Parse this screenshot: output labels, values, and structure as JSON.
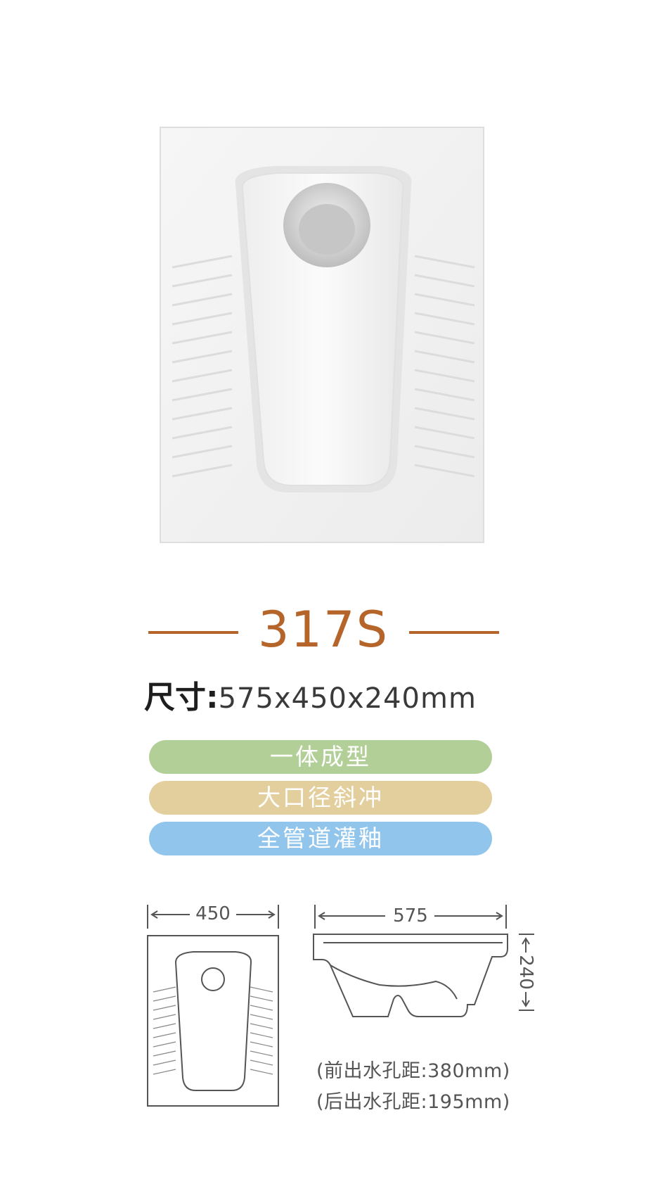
{
  "product": {
    "model": "317S",
    "size_label": "尺寸:",
    "size_value": "575x450x240mm"
  },
  "features": [
    {
      "label": "一体成型",
      "color": "#b3cf98"
    },
    {
      "label": "大口径斜冲",
      "color": "#e3cf9d"
    },
    {
      "label": "全管道灌釉",
      "color": "#92c5ec"
    }
  ],
  "diagram": {
    "top_width": "450",
    "side_length": "575",
    "side_height": "240"
  },
  "specs": {
    "front_outlet": "(前出水孔距:380mm)",
    "rear_outlet": "(后出水孔距:195mm)"
  },
  "colors": {
    "accent": "#b5652a",
    "line": "#555555"
  }
}
